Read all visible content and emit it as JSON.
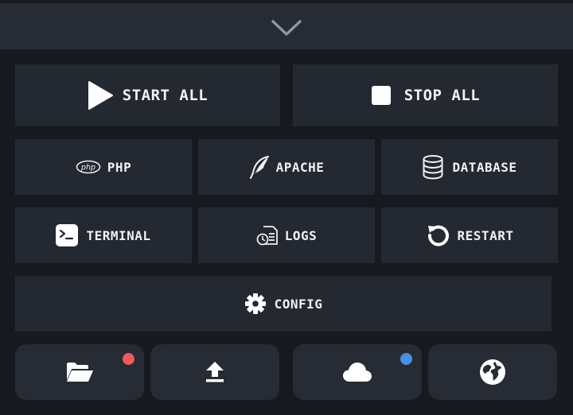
{
  "colors": {
    "background": "#161a20",
    "panel": "#232831",
    "text": "#eef1f5",
    "badge_red": "#ef5a5a",
    "badge_blue": "#4a90e2"
  },
  "controls": {
    "start_all_label": "START ALL",
    "stop_all_label": "STOP ALL",
    "php_label": "PHP",
    "apache_label": "APACHE",
    "database_label": "DATABASE",
    "terminal_label": "TERMINAL",
    "logs_label": "LOGS",
    "restart_label": "RESTART",
    "config_label": "CONFIG",
    "php_logo_text": "php"
  },
  "icons": {
    "collapse": "chevron-down-icon",
    "start": "play-icon",
    "stop": "stop-icon",
    "php": "php-logo-icon",
    "apache": "feather-icon",
    "database": "database-icon",
    "terminal": "terminal-icon",
    "logs": "logs-icon",
    "restart": "restart-icon",
    "config": "gear-icon",
    "folder": "folder-open-icon",
    "upload": "upload-icon",
    "cloud": "cloud-icon",
    "web": "globe-icon"
  }
}
